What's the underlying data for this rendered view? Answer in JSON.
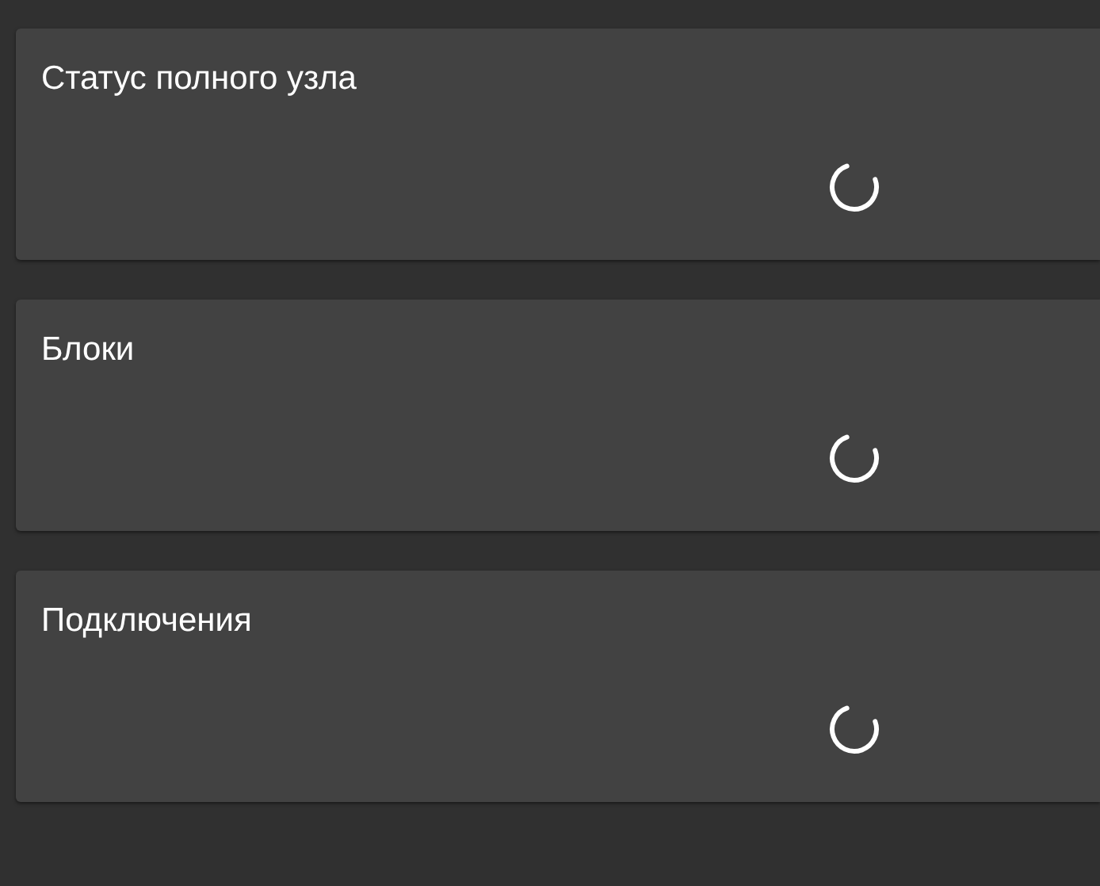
{
  "panels": [
    {
      "title": "Статус полного узла",
      "loading": true
    },
    {
      "title": "Блоки",
      "loading": true
    },
    {
      "title": "Подключения",
      "loading": true
    }
  ]
}
